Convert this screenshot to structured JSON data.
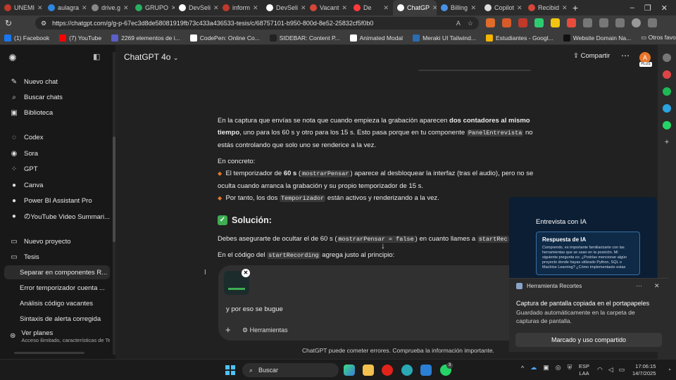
{
  "browser": {
    "tabs": [
      {
        "label": "UNEMI",
        "color": "#c0392b"
      },
      {
        "label": "aulagra",
        "color": "#2e86de"
      },
      {
        "label": "drive.g",
        "color": "#888888"
      },
      {
        "label": "GRUPO",
        "color": "#27ae60"
      },
      {
        "label": "DevSeli",
        "color": "#ffffff"
      },
      {
        "label": "inform",
        "color": "#c0392b"
      },
      {
        "label": "DevSeli",
        "color": "#ffffff"
      },
      {
        "label": "Vacant",
        "color": "#d44638"
      },
      {
        "label": "De",
        "color": "#ff3b3b"
      },
      {
        "label": "ChatGP",
        "color": "#ffffff"
      },
      {
        "label": "Billing",
        "color": "#4a90e2"
      },
      {
        "label": "Copilot",
        "color": "#dddddd"
      },
      {
        "label": "Recibid",
        "color": "#d44638"
      }
    ],
    "url": "https://chatgpt.com/g/g-p-67ec3d8de58081919fb73c433a436533-tesis/c/68757101-b950-800d-8e52-25832cf5f0b0",
    "bookmarks": [
      {
        "label": "(1) Facebook",
        "color": "#1877f2"
      },
      {
        "label": "(7) YouTube",
        "color": "#ff0000"
      },
      {
        "label": "2269 elementos de i...",
        "color": "#5b5fc7"
      },
      {
        "label": "CodePen: Online Co...",
        "color": "#ffffff"
      },
      {
        "label": "SIDEBAR: Content P...",
        "color": "#222222"
      },
      {
        "label": "Animated Modal",
        "color": "#ffffff"
      },
      {
        "label": "Meraki UI Tailwind...",
        "color": "#2b6cb0"
      },
      {
        "label": "Estudiantes - Googl...",
        "color": "#f4b400"
      },
      {
        "label": "Website Domain Na...",
        "color": "#111111"
      }
    ],
    "more_favorites": "Otros favoritos"
  },
  "sidebar": {
    "items": [
      {
        "label": "Nuevo chat",
        "icon": "edit-icon",
        "glyph": "✎"
      },
      {
        "label": "Buscar chats",
        "icon": "search-icon",
        "glyph": "⌕"
      },
      {
        "label": "Biblioteca",
        "icon": "library-icon",
        "glyph": "▣"
      },
      {
        "label": "Codex",
        "icon": "codex-icon",
        "glyph": "◌"
      },
      {
        "label": "Sora",
        "icon": "sora-icon",
        "glyph": "◉"
      },
      {
        "label": "GPT",
        "icon": "gpt-icon",
        "glyph": "⁘"
      },
      {
        "label": "Canva",
        "icon": "canva-icon",
        "glyph": "●"
      },
      {
        "label": "Power BI Assistant Pro",
        "icon": "powerbi-icon",
        "glyph": "●"
      },
      {
        "label": "のYouTube Video Summari...",
        "icon": "youtube-summary-icon",
        "glyph": "●"
      },
      {
        "label": "Nuevo proyecto",
        "icon": "folder-plus-icon",
        "glyph": "▭"
      },
      {
        "label": "Tesis",
        "icon": "folder-icon",
        "glyph": "▭"
      }
    ],
    "chats": [
      {
        "label": "Separar en componentes R..."
      },
      {
        "label": "Error temporizador cuenta ..."
      },
      {
        "label": "Análisis código vacantes"
      },
      {
        "label": "Sintaxis de alerta corregida"
      }
    ],
    "plans_title": "Ver planes",
    "plans_sub": "Acceso ilimitado, características de Te"
  },
  "header": {
    "model": "ChatGPT 4o",
    "share": "Compartir",
    "avatar": "A",
    "plan_badge": "PLUS"
  },
  "message": {
    "p1_a": "En la captura que envías se nota que cuando empieza la grabación aparecen ",
    "p1_b": "dos contadores al mismo tiempo",
    "p1_c": ", uno para los 60 s y otro para los 15 s. Esto pasa porque en tu componente ",
    "p1_code": "PanelEntrevista",
    "p1_d": " no estás controlando que solo uno se renderice a la vez.",
    "p2": "En concreto:",
    "b1_a": "El temporizador de ",
    "b1_b": "60 s",
    "b1_c": " (",
    "b1_code": "mostrarPensar",
    "b1_d": ") aparece al desbloquear la interfaz (tras el audio), pero no se oculta cuando arranca la grabación y su propio temporizador de 15 s.",
    "b2_a": "Por tanto, los dos ",
    "b2_code": "Temporizador",
    "b2_b": " están activos y renderizando a la vez.",
    "solution": "Solución:",
    "p3_a": "Debes asegurarte de ocultar el de 60 s (",
    "p3_code": "mostrarPensar = false",
    "p3_b": ") en cuanto llames a ",
    "p3_code2": "startRec",
    "p4_a": "En el código del ",
    "p4_code": "startRecording",
    "p4_b": " agrega justo al principio:"
  },
  "composer": {
    "text": "y por eso se bugue",
    "tools": "Herramientas"
  },
  "disclaimer": "ChatGPT puede cometer errores. Comprueba la información importante.",
  "popup": {
    "title": "Entrevista con IA",
    "card_title": "Respuesta de IA",
    "card_body": "Comprendo, es importante familiarizarte con las herramientas que se usan en la posición. Mi siguiente pregunta es: ¿Podrías mencionar algún proyecto donde hayas utilizado Python, SQL o Machine Learning? ¿Cómo implementaste estas"
  },
  "toast": {
    "app": "Herramienta Recortes",
    "heading": "Captura de pantalla copiada en el portapapeles",
    "message": "Guardado automáticamente en la carpeta de capturas de pantalla.",
    "button": "Marcado y uso compartido"
  },
  "taskbar": {
    "search": "Buscar",
    "lang_top": "ESP",
    "lang_bottom": "LAA",
    "time": "17:06:15",
    "date": "14/7/2025",
    "whatsapp_badge": "3"
  }
}
